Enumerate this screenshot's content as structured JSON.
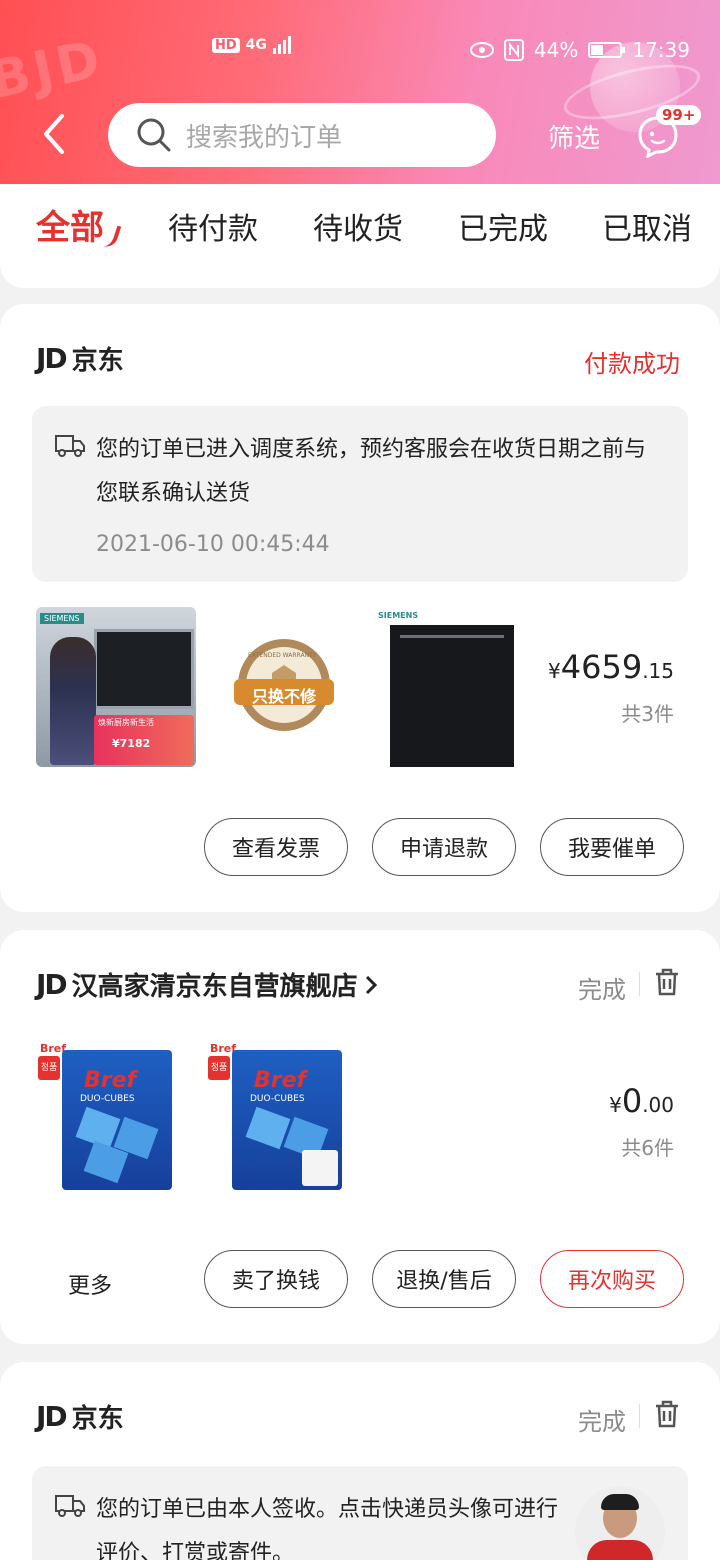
{
  "status_bar": {
    "hd": "HD",
    "net": "4G",
    "battery": "44%",
    "time": "17:39",
    "battery_level": 0.44
  },
  "header": {
    "search_placeholder": "搜索我的订单",
    "filter_label": "筛选",
    "message_badge": "99+"
  },
  "tabs": [
    {
      "label": "全部",
      "active": true
    },
    {
      "label": "待付款"
    },
    {
      "label": "待收货"
    },
    {
      "label": "已完成"
    },
    {
      "label": "已取消"
    }
  ],
  "orders": [
    {
      "store": "京东",
      "status": "付款成功",
      "notice": "您的订单已进入调度系统，预约客服会在收货日期之前与您联系确认送货",
      "notice_time": "2021-06-10 00:45:44",
      "products": [
        {
          "brand": "SIEMENS",
          "promo": "焕新厨房新生活",
          "price_tag": "¥7182"
        },
        {
          "warranty_top": "EXTENDED WARRANTY",
          "warranty_text": "只换不修"
        },
        {
          "brand": "SIEMENS"
        }
      ],
      "price_currency": "¥",
      "price_int": "4659",
      "price_dec": ".15",
      "count": "共3件",
      "buttons": [
        "查看发票",
        "申请退款",
        "我要催单"
      ]
    },
    {
      "store": "汉高家清京东自营旗舰店",
      "status": "完成",
      "products": [
        {
          "brand": "Bref",
          "sub": "DUO-CUBES",
          "tag": "정품"
        },
        {
          "brand": "Bref",
          "sub": "DUO-CUBES",
          "tag": "정품"
        }
      ],
      "price_currency": "¥",
      "price_int": "0",
      "price_dec": ".00",
      "count": "共6件",
      "more": "更多",
      "buttons": [
        "卖了换钱",
        "退换/售后",
        "再次购买"
      ]
    },
    {
      "store": "京东",
      "status": "完成",
      "notice": "您的订单已由本人签收。点击快递员头像可进行评价、打赏或寄件。"
    }
  ],
  "colors": {
    "accent": "#e5322e",
    "gradient_start": "#ff4f53",
    "gradient_end": "#ef9ad0"
  }
}
